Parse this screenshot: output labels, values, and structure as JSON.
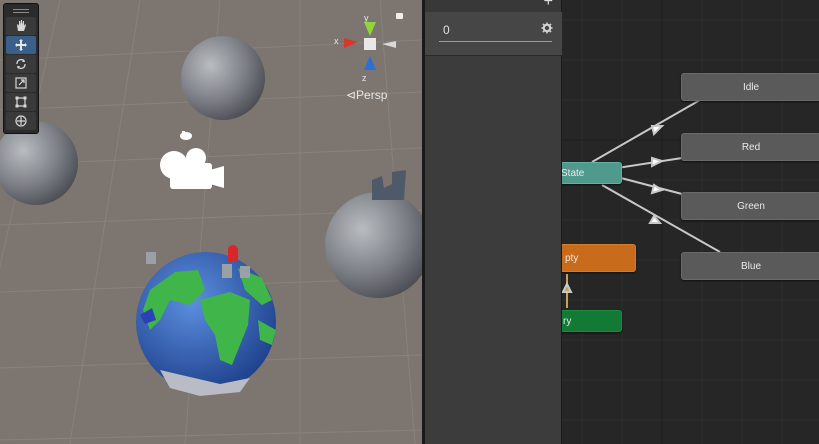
{
  "scene": {
    "persp_label": "⊲Persp",
    "gizmo": {
      "x_label": "x",
      "y_label": "y",
      "z_label": "z"
    },
    "tools": [
      {
        "name": "hand-tool",
        "icon": "hand-icon",
        "active": false
      },
      {
        "name": "move-tool",
        "icon": "move-icon",
        "active": true
      },
      {
        "name": "rotate-tool",
        "icon": "rotate-icon",
        "active": false
      },
      {
        "name": "scale-tool",
        "icon": "scale-icon",
        "active": false
      },
      {
        "name": "rect-tool",
        "icon": "rect-icon",
        "active": false
      },
      {
        "name": "transform-tool",
        "icon": "transform-icon",
        "active": false
      }
    ]
  },
  "parameters": {
    "add_label": "+",
    "param_value": "0",
    "gear_icon": "gear-icon"
  },
  "graph": {
    "nodes": {
      "idle": "Idle",
      "red": "Red",
      "green": "Green",
      "blue": "Blue",
      "entry_partial": "State",
      "any_partial": "pty",
      "entry2_partial": "ry"
    },
    "colors": {
      "state": "#5a5a5a",
      "default_state": "#4f9a8c",
      "any_state": "#c86b1a",
      "entry": "#137a35"
    }
  }
}
